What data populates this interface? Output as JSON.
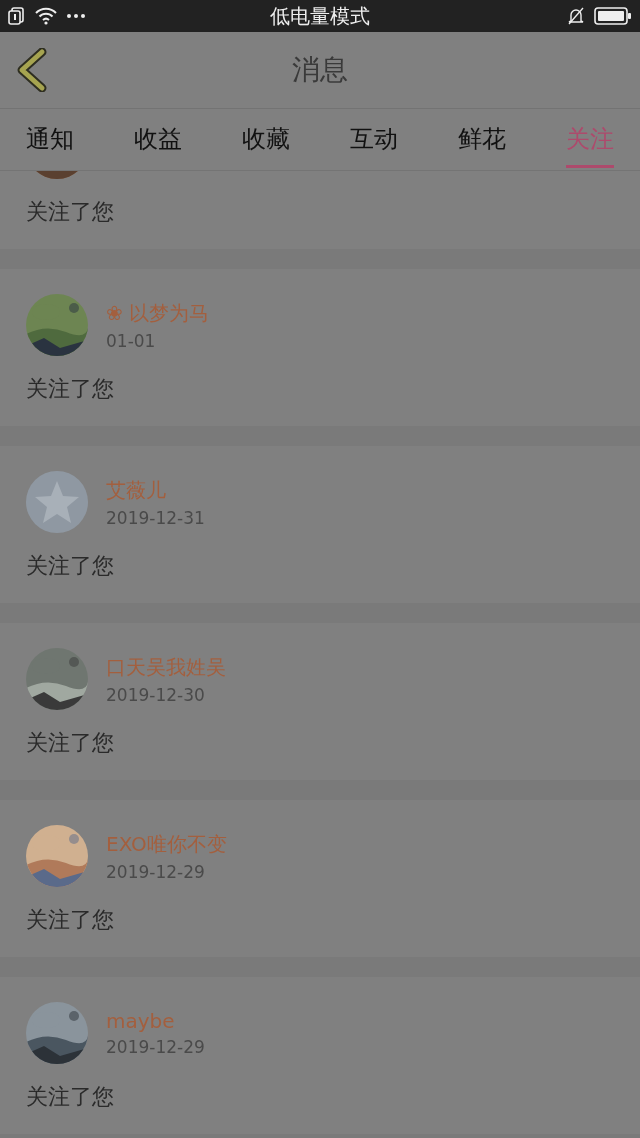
{
  "status_bar": {
    "title": "低电量模式"
  },
  "header": {
    "title": "消息"
  },
  "tabs": [
    {
      "label": "通知",
      "selected": false
    },
    {
      "label": "收益",
      "selected": false
    },
    {
      "label": "收藏",
      "selected": false
    },
    {
      "label": "互动",
      "selected": false
    },
    {
      "label": "鲜花",
      "selected": false
    },
    {
      "label": "关注",
      "selected": true
    }
  ],
  "messages": [
    {
      "text": "关注了您"
    },
    {
      "name": "❀ 以梦为马",
      "date": "01-01",
      "text": "关注了您"
    },
    {
      "kind": "default",
      "name": "艾薇儿",
      "date": "2019-12-31",
      "text": "关注了您"
    },
    {
      "name": "口天吴我姓吴",
      "date": "2019-12-30",
      "text": "关注了您"
    },
    {
      "name": "EXO唯你不变",
      "date": "2019-12-29",
      "text": "关注了您"
    },
    {
      "name": "maybe",
      "date": "2019-12-29",
      "text": "关注了您"
    }
  ]
}
